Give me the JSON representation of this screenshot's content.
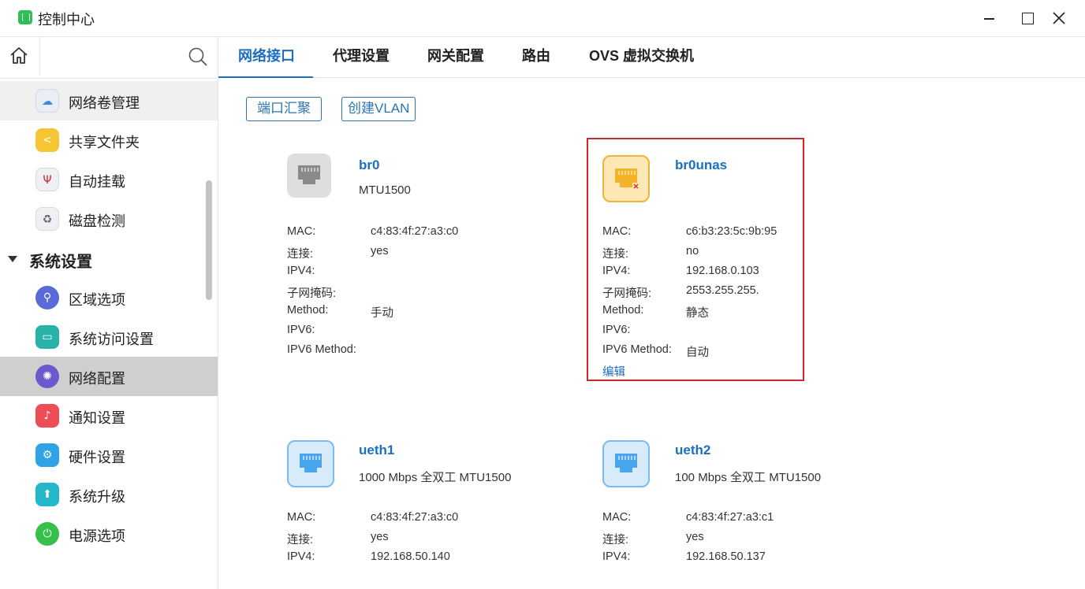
{
  "window": {
    "title": "控制中心"
  },
  "sidebar": {
    "items_above": [
      {
        "label": "网络卷管理",
        "icon": "cloud-drive-icon"
      },
      {
        "label": "共享文件夹",
        "icon": "share-folder-icon"
      },
      {
        "label": "自动挂载",
        "icon": "usb-mount-icon"
      },
      {
        "label": "磁盘检测",
        "icon": "disk-check-icon"
      }
    ],
    "group": {
      "label": "系统设置"
    },
    "items": [
      {
        "label": "区域选项",
        "icon": "location-icon"
      },
      {
        "label": "系统访问设置",
        "icon": "access-icon"
      },
      {
        "label": "网络配置",
        "icon": "network-icon"
      },
      {
        "label": "通知设置",
        "icon": "bell-icon"
      },
      {
        "label": "硬件设置",
        "icon": "hardware-icon"
      },
      {
        "label": "系统升级",
        "icon": "upgrade-icon"
      },
      {
        "label": "电源选项",
        "icon": "power-icon"
      }
    ]
  },
  "tabs": [
    {
      "label": "网络接口"
    },
    {
      "label": "代理设置"
    },
    {
      "label": "网关配置"
    },
    {
      "label": "路由"
    },
    {
      "label": "OVS 虚拟交换机"
    }
  ],
  "actions": {
    "bond": "端口汇聚",
    "vlan": "创建VLAN"
  },
  "labels": {
    "mac": "MAC:",
    "connected": "连接:",
    "ipv4": "IPV4:",
    "netmask": "子网掩码:",
    "method": "Method:",
    "ipv6": "IPV6:",
    "ipv6_method": "IPV6 Method:",
    "edit": "编辑"
  },
  "interfaces": {
    "br0": {
      "name": "br0",
      "sub": "MTU1500",
      "mac": "c4:83:4f:27:a3:c0",
      "connected": "yes",
      "ipv4": "",
      "netmask": "",
      "method": "手动",
      "ipv6": "",
      "ipv6_method": ""
    },
    "br0unas": {
      "name": "br0unas",
      "sub": "",
      "mac": "c6:b3:23:5c:9b:95",
      "connected": "no",
      "ipv4": "192.168.0.103",
      "netmask": "2553.255.255.",
      "method": "静态",
      "ipv6": "",
      "ipv6_method": "自动"
    },
    "ueth1": {
      "name": "ueth1",
      "sub": "1000 Mbps 全双工 MTU1500",
      "mac": "c4:83:4f:27:a3:c0",
      "connected": "yes",
      "ipv4": "192.168.50.140"
    },
    "ueth2": {
      "name": "ueth2",
      "sub": "100 Mbps 全双工 MTU1500",
      "mac": "c4:83:4f:27:a3:c1",
      "connected": "yes",
      "ipv4": "192.168.50.137"
    }
  },
  "colors": {
    "accent": "#1a6fc1",
    "highlight": "#d0262d",
    "active_item_bg": "#cfcfcf"
  }
}
